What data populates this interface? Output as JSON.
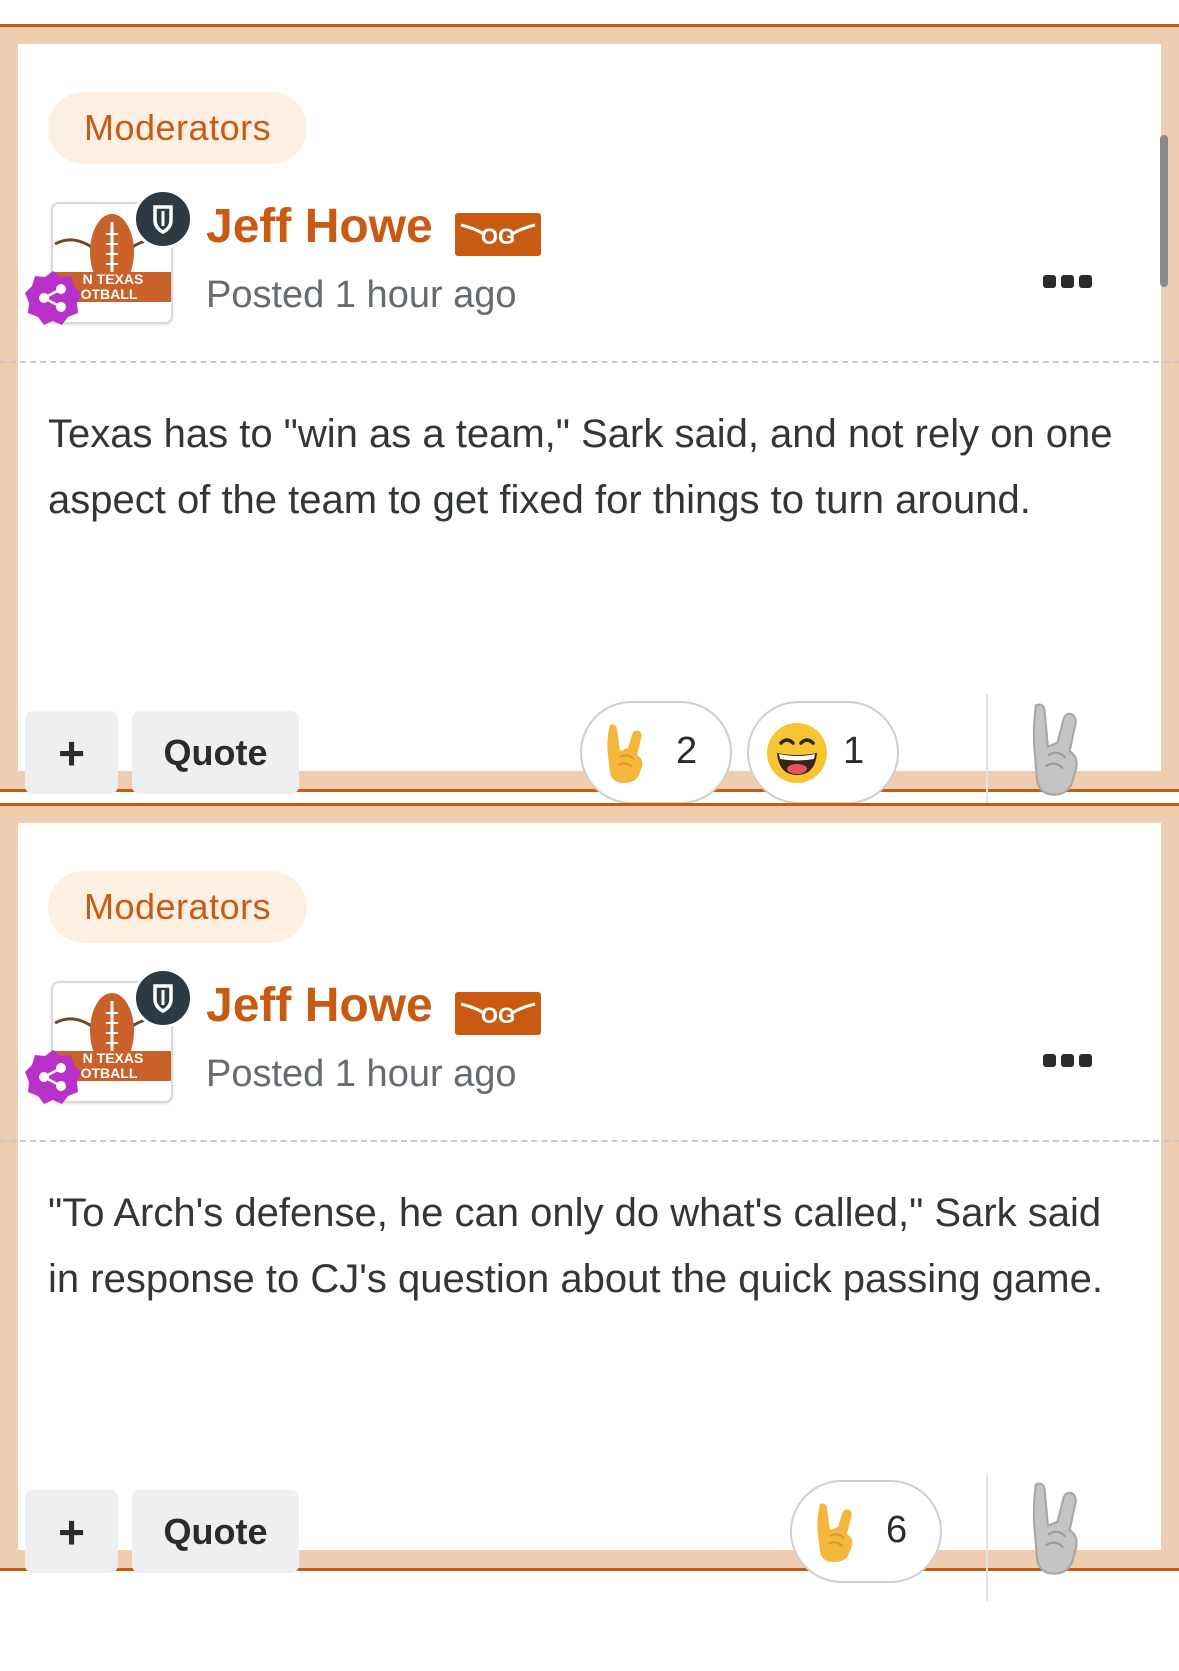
{
  "posts": [
    {
      "group": "Moderators",
      "author": "Jeff Howe",
      "badge_text": "OG",
      "time": "Posted 1 hour ago",
      "avatar_text": [
        "N TEXAS",
        "OTBALL"
      ],
      "body": "Texas has to \"win as a team,\" Sark said, and not rely on one aspect of the team to get fixed for things to turn around.",
      "multiquote_label": "+",
      "quote_label": "Quote",
      "reactions": [
        {
          "icon": "horns-up-hand-icon",
          "count": "2"
        },
        {
          "icon": "laughing-face-icon",
          "count": "1"
        }
      ]
    },
    {
      "group": "Moderators",
      "author": "Jeff Howe",
      "badge_text": "OG",
      "time": "Posted 1 hour ago",
      "avatar_text": [
        "N TEXAS",
        "OTBALL"
      ],
      "body": "\"To Arch's defense, he can only do what's called,\" Sark said in response to CJ's question about the quick passing game.",
      "multiquote_label": "+",
      "quote_label": "Quote",
      "reactions": [
        {
          "icon": "horns-up-hand-icon",
          "count": "6"
        }
      ]
    }
  ],
  "colors": {
    "accent": "#c85a12",
    "post_frame": "#eecdb0",
    "group_badge_bg": "#fdf0e3",
    "rank_badge": "#b832c9",
    "moderator_badge": "#2d3a44",
    "reaction_gold": "#f4b73c",
    "reaction_inactive": "#bdbdbd"
  }
}
